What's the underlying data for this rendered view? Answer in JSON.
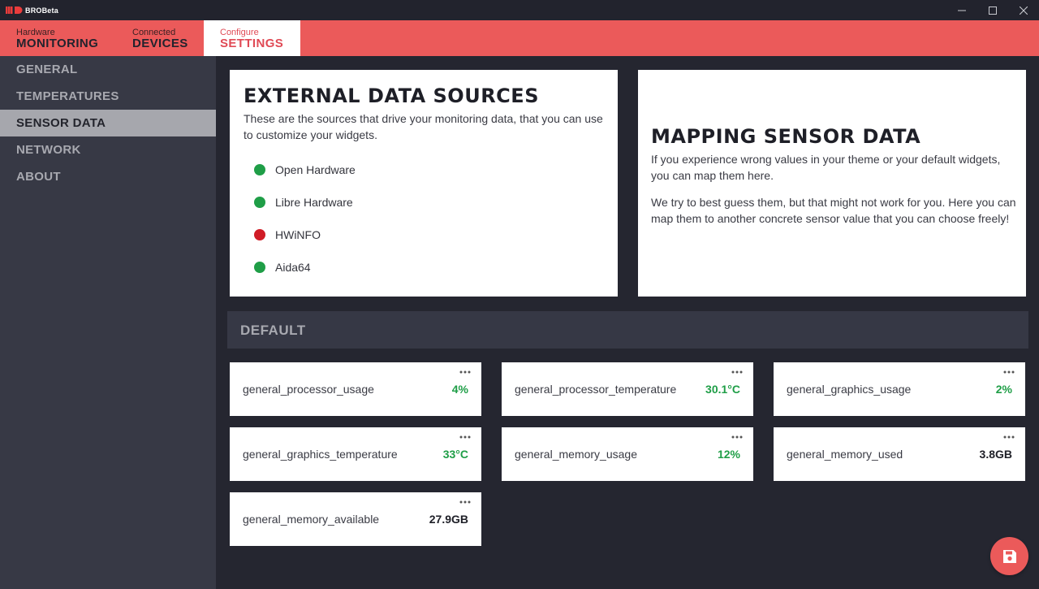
{
  "titlebar": {
    "logo_mark": "MD",
    "logo_text": "BROBeta",
    "buttons": [
      "minimize-icon",
      "maximize-icon",
      "close-icon"
    ]
  },
  "topnav": {
    "tabs": [
      {
        "small": "Hardware",
        "big": "MONITORING",
        "active": false
      },
      {
        "small": "Connected",
        "big": "DEVICES",
        "active": false
      },
      {
        "small": "Configure",
        "big": "SETTINGS",
        "active": true
      }
    ]
  },
  "sidebar": {
    "items": [
      {
        "label": "GENERAL",
        "active": false
      },
      {
        "label": "TEMPERATURES",
        "active": false
      },
      {
        "label": "SENSOR DATA",
        "active": true
      },
      {
        "label": "NETWORK",
        "active": false
      },
      {
        "label": "ABOUT",
        "active": false
      }
    ]
  },
  "external": {
    "title": "EXTERNAL DATA SOURCES",
    "description": "These are the sources that drive your monitoring data, that you can use to customize your widgets.",
    "sources": [
      {
        "name": "Open Hardware",
        "status": "green"
      },
      {
        "name": "Libre Hardware",
        "status": "green"
      },
      {
        "name": "HWiNFO",
        "status": "red"
      },
      {
        "name": "Aida64",
        "status": "green"
      }
    ]
  },
  "mapping": {
    "title": "MAPPING SENSOR DATA",
    "para1": "If you experience wrong values in your theme or your default widgets, you can map them here.",
    "para2": "We try to best guess them, but that might not work for you. Here you can map them to another concrete sensor value that you can choose freely!"
  },
  "default_section": {
    "label": "DEFAULT"
  },
  "sensors": [
    {
      "key": "general_processor_usage",
      "value": "4%",
      "color": "green"
    },
    {
      "key": "general_processor_temperature",
      "value": "30.1°C",
      "color": "green"
    },
    {
      "key": "general_graphics_usage",
      "value": "2%",
      "color": "green"
    },
    {
      "key": "general_graphics_temperature",
      "value": "33°C",
      "color": "green"
    },
    {
      "key": "general_memory_usage",
      "value": "12%",
      "color": "green"
    },
    {
      "key": "general_memory_used",
      "value": "3.8GB",
      "color": "dark"
    },
    {
      "key": "general_memory_available",
      "value": "27.9GB",
      "color": "dark"
    }
  ],
  "fab": {
    "icon": "save-icon"
  },
  "colors": {
    "accent": "#eb5a5a",
    "status_green": "#1f9e47",
    "status_red": "#d01c26",
    "sidebar_bg": "#373945",
    "main_bg": "#252630"
  }
}
